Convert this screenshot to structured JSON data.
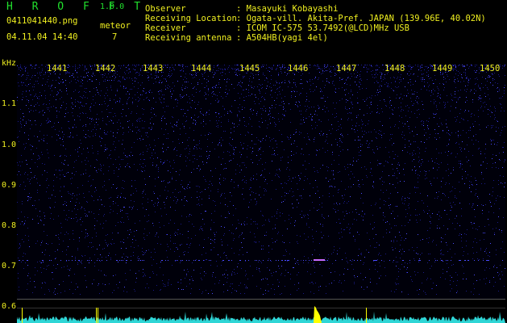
{
  "header": {
    "app_title": "H R O F F T",
    "app_version": "1.0.0",
    "filename": "0411041440.png",
    "datetime": "04.11.04 14:40",
    "count_label": "meteor",
    "count_value": "7",
    "info": [
      {
        "label": "Observer",
        "value": ": Masayuki Kobayashi"
      },
      {
        "label": "Receiving Location",
        "value": ": Ogata-vill. Akita-Pref. JAPAN (139.96E, 40.02N)"
      },
      {
        "label": "Receiver",
        "value": ": ICOM IC-575 53.7492(@LCD)MHz USB"
      },
      {
        "label": "Receiving antenna",
        "value": ": A504HB(yagi 4el)"
      }
    ]
  },
  "axis": {
    "y_unit": "kHz",
    "y_ticks": [
      "1.1",
      "1.0",
      "0.9",
      "0.8",
      "0.7",
      "0.6"
    ],
    "x_ticks": [
      "1441",
      "1442",
      "1443",
      "1444",
      "1445",
      "1446",
      "1447",
      "1448",
      "1449",
      "1450"
    ]
  },
  "colors": {
    "title": "#21e02d",
    "header_text": "#f0f020",
    "noise_dim": "#1a1a8a",
    "noise_bright": "#4b4bff",
    "spectrum": "#2fd6d6",
    "peak": "#ffff00"
  }
}
